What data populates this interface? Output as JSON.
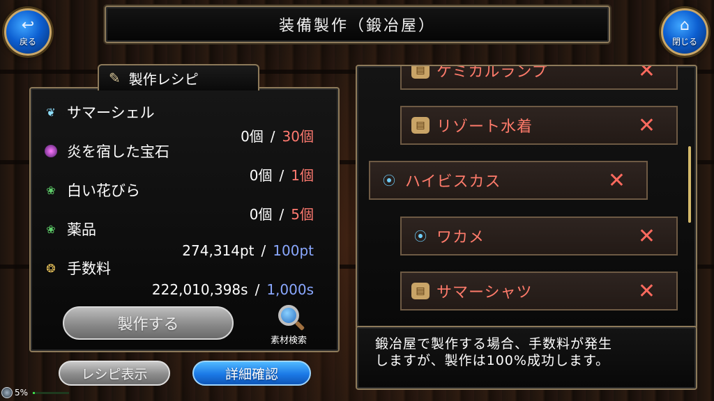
{
  "header": {
    "title": "装備製作（鍛冶屋）"
  },
  "nav": {
    "back_label": "戻る",
    "close_label": "閉じる"
  },
  "recipe": {
    "tab_label": "製作レシピ",
    "materials": [
      {
        "name": "サマーシェル",
        "have": "0個",
        "need": "30個",
        "icon": "shell-icon"
      },
      {
        "name": "炎を宿した宝石",
        "have": "0個",
        "need": "1個",
        "icon": "gem-icon"
      },
      {
        "name": "白い花びら",
        "have": "0個",
        "need": "5個",
        "icon": "leaf-icon"
      },
      {
        "name": "薬品",
        "have": "274,314pt",
        "need": "100pt",
        "icon": "leaf-icon"
      },
      {
        "name": "手数料",
        "have": "222,010,398s",
        "need": "1,000s",
        "icon": "coin-icon"
      }
    ],
    "separator": "/",
    "make_label": "製作する",
    "search_label": "素材検索"
  },
  "bottom_buttons": {
    "recipe_view_label": "レシピ表示",
    "detail_label": "詳細確認"
  },
  "status": {
    "exp_text": "5%",
    "exp_fraction": 0.05
  },
  "item_list": {
    "items": [
      {
        "name": "ケミカルランプ",
        "icon": "scroll-icon",
        "partial": true
      },
      {
        "name": "リゾート水着",
        "icon": "scroll-icon"
      },
      {
        "name": "ハイビスカス",
        "icon": "shell-icon",
        "selected": true
      },
      {
        "name": "ワカメ",
        "icon": "shell-icon"
      },
      {
        "name": "サマーシャツ",
        "icon": "scroll-icon"
      }
    ],
    "unavailable_mark": "✕"
  },
  "description": {
    "line1": "鍛冶屋で製作する場合、手数料が発生",
    "line2": "しますが、製作は100%成功します。"
  },
  "colors": {
    "frame": "#8d7a5a",
    "item_name": "#ff7b6b",
    "need_red": "#ff7a70",
    "need_blue": "#8aa8ff",
    "button_blue": "#1b79e6"
  }
}
